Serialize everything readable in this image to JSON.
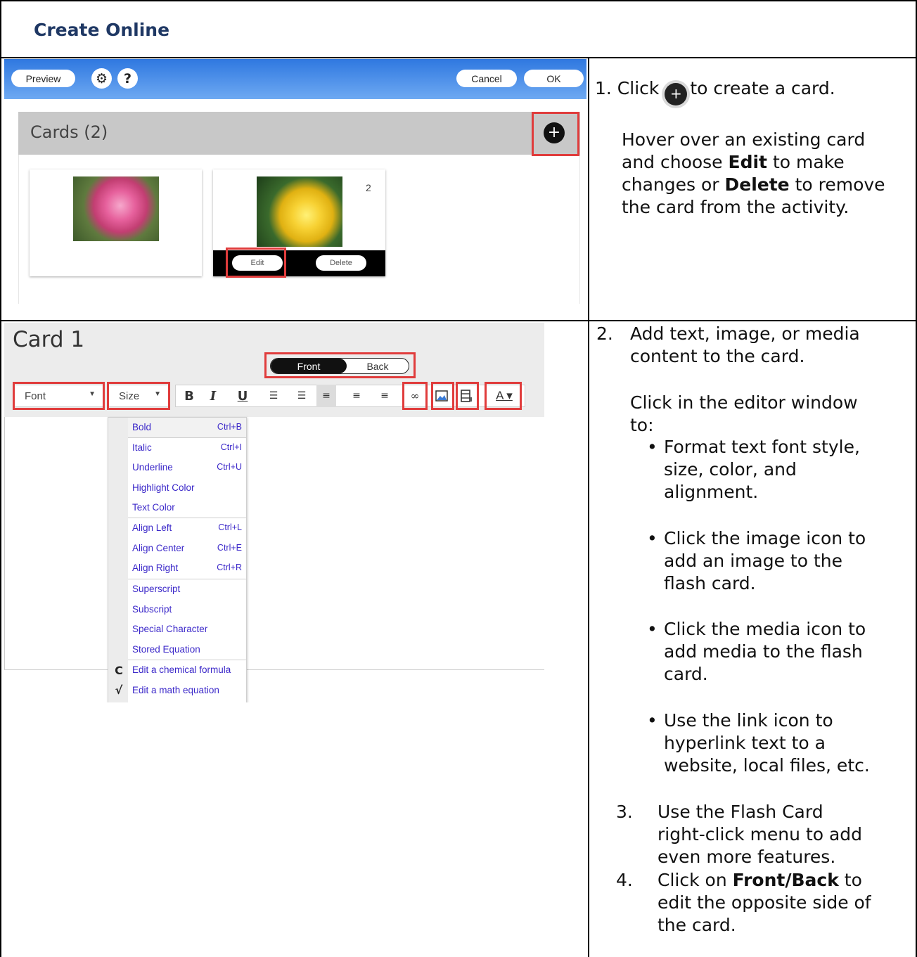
{
  "header": {
    "title": "Create Online"
  },
  "shot1": {
    "preview_label": "Preview",
    "settings_icon": "gear-icon",
    "help_label": "?",
    "cancel_label": "Cancel",
    "ok_label": "OK",
    "cards_title": "Cards (2)",
    "add_label": "+",
    "card2_number": "2",
    "edit_label": "Edit",
    "delete_label": "Delete"
  },
  "shot2": {
    "card_title": "Card 1",
    "front_label": "Front",
    "back_label": "Back",
    "font_label": "Font",
    "size_label": "Size",
    "bold_label": "B",
    "italic_label": "I",
    "underline_label": "U",
    "menu": [
      {
        "label": "Bold",
        "shortcut": "Ctrl+B"
      },
      {
        "label": "Italic",
        "shortcut": "Ctrl+I"
      },
      {
        "label": "Underline",
        "shortcut": "Ctrl+U"
      },
      {
        "label": "Highlight Color",
        "shortcut": ""
      },
      {
        "label": "Text Color",
        "shortcut": ""
      },
      {
        "label": "Align Left",
        "shortcut": "Ctrl+L"
      },
      {
        "label": "Align Center",
        "shortcut": "Ctrl+E"
      },
      {
        "label": "Align Right",
        "shortcut": "Ctrl+R"
      },
      {
        "label": "Superscript",
        "shortcut": ""
      },
      {
        "label": "Subscript",
        "shortcut": ""
      },
      {
        "label": "Special Character",
        "shortcut": ""
      },
      {
        "label": "Stored Equation",
        "shortcut": ""
      },
      {
        "label": "Edit a chemical formula",
        "shortcut": ""
      },
      {
        "label": "Edit a math equation",
        "shortcut": ""
      }
    ],
    "chem_icon_label": "C",
    "math_icon_label": "√"
  },
  "instructions": {
    "step1_num": "1. Click",
    "step1_rest": "to create a card.",
    "step1_hover_a": "Hover over an existing card",
    "step1_hover_b_pre": "and choose ",
    "step1_hover_b_bold": "Edit",
    "step1_hover_b_post": " to make",
    "step1_hover_c_pre": "changes or ",
    "step1_hover_c_bold": "Delete",
    "step1_hover_c_post": " to remove",
    "step1_hover_d": "the card from the activity.",
    "step2_num": "2.",
    "step2_a": "Add text, image, or media",
    "step2_b": "content to the card.",
    "step2_click_a": "Click in the editor window",
    "step2_click_b": "to:",
    "bullet1": [
      "Format text font style,",
      "size, color, and",
      "alignment."
    ],
    "bullet2": [
      "Click the image icon to",
      "add an image to the",
      "flash card."
    ],
    "bullet3": [
      "Click the media icon to",
      "add media to the flash",
      "card."
    ],
    "bullet4": [
      "Use the link icon to",
      "hyperlink text to a",
      "website, local files, etc."
    ],
    "step3_num": "3.",
    "step3": [
      "Use the Flash Card",
      "right-click menu to add",
      "even more features."
    ],
    "step4_num": "4.",
    "step4_a_pre": "Click on ",
    "step4_a_bold": "Front/Back",
    "step4_a_post": " to",
    "step4_b": "edit the opposite side of",
    "step4_c": "the card."
  },
  "colors": {
    "title": "#1f3864",
    "highlight_box": "#e03c3c",
    "toolbar_blue": "#2f78e0",
    "menu_text": "#3b28c9"
  }
}
